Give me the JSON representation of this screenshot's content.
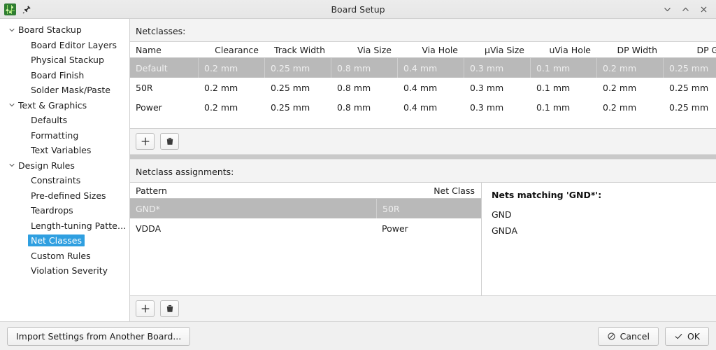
{
  "window": {
    "title": "Board Setup",
    "app_icon": "pcb-board-icon",
    "pin_icon": "pin-icon",
    "controls": [
      {
        "name": "minimize-button",
        "icon": "chevron-down-icon"
      },
      {
        "name": "maximize-button",
        "icon": "chevron-up-icon"
      },
      {
        "name": "close-button",
        "icon": "close-icon"
      }
    ]
  },
  "sidebar": {
    "items": [
      {
        "label": "Board Stackup",
        "level": 0,
        "expanded": true,
        "selected": false
      },
      {
        "label": "Board Editor Layers",
        "level": 1,
        "expanded": null,
        "selected": false
      },
      {
        "label": "Physical Stackup",
        "level": 1,
        "expanded": null,
        "selected": false
      },
      {
        "label": "Board Finish",
        "level": 1,
        "expanded": null,
        "selected": false
      },
      {
        "label": "Solder Mask/Paste",
        "level": 1,
        "expanded": null,
        "selected": false
      },
      {
        "label": "Text & Graphics",
        "level": 0,
        "expanded": true,
        "selected": false
      },
      {
        "label": "Defaults",
        "level": 1,
        "expanded": null,
        "selected": false
      },
      {
        "label": "Formatting",
        "level": 1,
        "expanded": null,
        "selected": false
      },
      {
        "label": "Text Variables",
        "level": 1,
        "expanded": null,
        "selected": false
      },
      {
        "label": "Design Rules",
        "level": 0,
        "expanded": true,
        "selected": false
      },
      {
        "label": "Constraints",
        "level": 1,
        "expanded": null,
        "selected": false
      },
      {
        "label": "Pre-defined Sizes",
        "level": 1,
        "expanded": null,
        "selected": false
      },
      {
        "label": "Teardrops",
        "level": 1,
        "expanded": null,
        "selected": false
      },
      {
        "label": "Length-tuning Patterns",
        "level": 1,
        "expanded": null,
        "selected": false
      },
      {
        "label": "Net Classes",
        "level": 1,
        "expanded": null,
        "selected": true
      },
      {
        "label": "Custom Rules",
        "level": 1,
        "expanded": null,
        "selected": false
      },
      {
        "label": "Violation Severity",
        "level": 1,
        "expanded": null,
        "selected": false
      }
    ]
  },
  "netclasses": {
    "label": "Netclasses:",
    "columns": [
      "Name",
      "Clearance",
      "Track Width",
      "Via Size",
      "Via Hole",
      "µVia Size",
      "uVia Hole",
      "DP Width",
      "DP Ga"
    ],
    "rows": [
      {
        "state": "disabled",
        "cells": [
          "Default",
          "0.2 mm",
          "0.25 mm",
          "0.8 mm",
          "0.4 mm",
          "0.3 mm",
          "0.1 mm",
          "0.2 mm",
          "0.25 mm"
        ]
      },
      {
        "state": "normal",
        "cells": [
          "50R",
          "0.2 mm",
          "0.25 mm",
          "0.8 mm",
          "0.4 mm",
          "0.3 mm",
          "0.1 mm",
          "0.2 mm",
          "0.25 mm"
        ]
      },
      {
        "state": "normal",
        "cells": [
          "Power",
          "0.2 mm",
          "0.25 mm",
          "0.8 mm",
          "0.4 mm",
          "0.3 mm",
          "0.1 mm",
          "0.2 mm",
          "0.25 mm"
        ]
      }
    ],
    "toolbar": {
      "add_icon": "plus-icon",
      "delete_icon": "trash-icon"
    }
  },
  "assignments": {
    "label": "Netclass assignments:",
    "columns": [
      "Pattern",
      "Net Class"
    ],
    "rows": [
      {
        "state": "selected",
        "cells": [
          "GND*",
          "50R"
        ]
      },
      {
        "state": "normal",
        "cells": [
          "VDDA",
          "Power"
        ]
      }
    ],
    "toolbar": {
      "add_icon": "plus-icon",
      "delete_icon": "trash-icon"
    }
  },
  "nets_panel": {
    "title": "Nets matching 'GND*':",
    "nets": [
      "GND",
      "GNDA"
    ]
  },
  "footer": {
    "import_label": "Import Settings from Another Board...",
    "cancel_label": "Cancel",
    "cancel_icon": "no-entry-icon",
    "ok_label": "OK",
    "ok_icon": "check-icon"
  },
  "colors": {
    "selection_blue": "#2f9fe0",
    "row_selected_grey": "#b9b9b9",
    "window_bg": "#f3f3f3"
  }
}
